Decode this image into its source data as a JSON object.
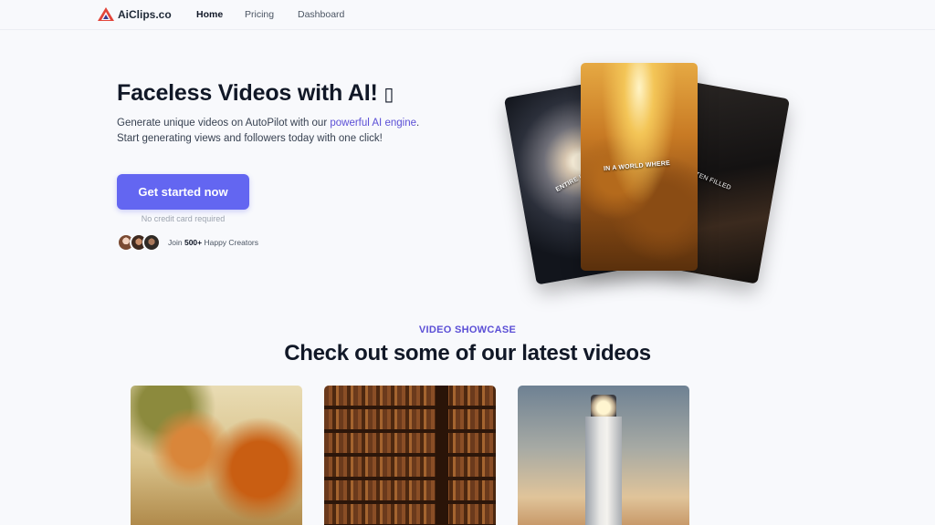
{
  "nav": {
    "brand": "AiClips.co",
    "links": [
      "Home",
      "Pricing",
      "Dashboard"
    ]
  },
  "hero": {
    "title": "Faceless Videos with AI! ",
    "title_glyph": "▯",
    "subtitle_pre": "Generate unique videos on AutoPilot with our ",
    "subtitle_link": "powerful AI engine",
    "subtitle_post": ".",
    "subtitle_line2": "Start generating views and followers today with one click!",
    "cta_label": "Get started now",
    "cta_note": "No credit card required",
    "join_pre": "Join ",
    "join_count": "500+",
    "join_post": " Happy Creators"
  },
  "cards": [
    {
      "caption": "ENTIRE UN"
    },
    {
      "caption": "IN A WORLD WHERE"
    },
    {
      "caption": "TEN FILLED"
    }
  ],
  "showcase": {
    "eyebrow": "VIDEO SHOWCASE",
    "title": "Check out some of our latest videos"
  },
  "colors": {
    "accent": "#6366f1",
    "link": "#5b4fd6",
    "background": "#f8f9fc"
  }
}
